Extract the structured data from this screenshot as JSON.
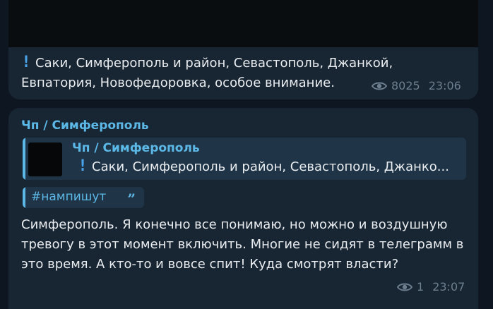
{
  "message1": {
    "line1": "Саки, Симферополь и район, Севастополь, Джанкой,",
    "line2": "Евпатория, Новофедоровка, особое внимание.",
    "views": "8025",
    "time": "23:06"
  },
  "message2": {
    "channel": "Чп / Симферополь",
    "reply": {
      "channel": "Чп / Симферополь",
      "text": "Саки, Симферополь и район, Севастополь, Джанко..."
    },
    "hashtag": "#нампишут",
    "body": "Симферополь. Я конечно все понимаю, но можно и воздушную тревогу в этот момент включить. Многие не сидят в телеграмм в это время. А кто-то и вовсе спит! Куда смотрят власти?",
    "views": "1",
    "time": "23:07"
  },
  "icons": {
    "exclamation": "exclamation-icon",
    "views": "eye-icon",
    "quote": "quote-icon"
  },
  "colors": {
    "background": "#0e1621",
    "bubble": "#182533",
    "accent": "#5cb8e6",
    "meta": "#6d7f8f"
  }
}
